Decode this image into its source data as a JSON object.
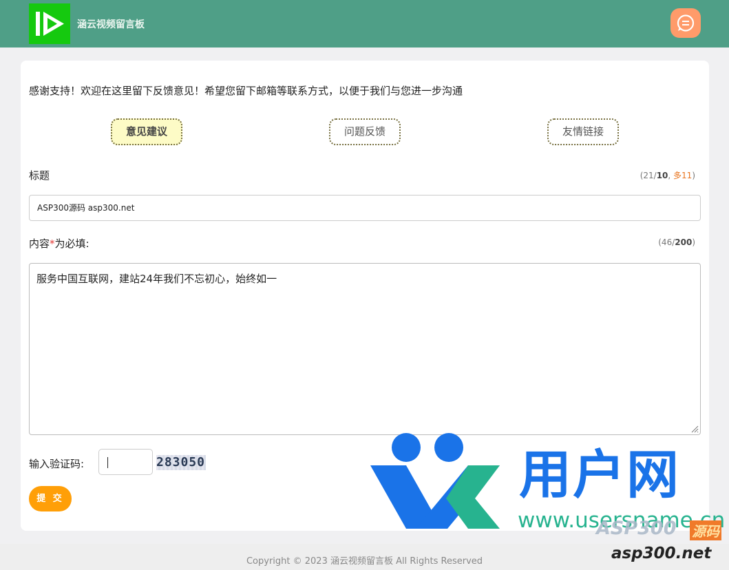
{
  "header": {
    "site_title": "涵云视频留言板",
    "logo_icon": "play-logo-icon",
    "message_icon": "chat-bubble-icon"
  },
  "intro": "感谢支持！欢迎在这里留下反馈意见！希望您留下邮箱等联系方式，以便于我们与您进一步沟通",
  "tabs": [
    {
      "label": "意见建议",
      "active": true
    },
    {
      "label": "问题反馈",
      "active": false
    },
    {
      "label": "友情链接",
      "active": false
    }
  ],
  "title_field": {
    "label": "标题",
    "value": "ASP300源码 asp300.net",
    "counter_open": "(21/",
    "counter_max": "10",
    "counter_sep": ", ",
    "counter_over": "多11",
    "counter_close": ")"
  },
  "content_field": {
    "label_prefix": "内容",
    "required_mark": "*",
    "label_suffix": "为必填:",
    "value": "服务中国互联网，建站24年我们不忘初心，始终如一",
    "counter_open": "(46/",
    "counter_max": "200",
    "counter_close": ")"
  },
  "captcha": {
    "label": "输入验证码:",
    "value": "",
    "image_text": "283050"
  },
  "submit_label": "提 交",
  "footer": {
    "copyright": "Copyright © 2023 涵云视频留言板 All Rights Reserved"
  },
  "watermark": {
    "brand": "用户网",
    "url": "www.usersname.cn",
    "asp_brand": "ASP300",
    "asp_badge": "源码",
    "asp_url": "asp300.net"
  },
  "colors": {
    "header_bg": "#4f9f87",
    "logo_bg": "#15c90f",
    "accent_orange": "#ff9f08",
    "active_tab_bg": "#fdfbc6",
    "over_limit": "#e8731c"
  }
}
